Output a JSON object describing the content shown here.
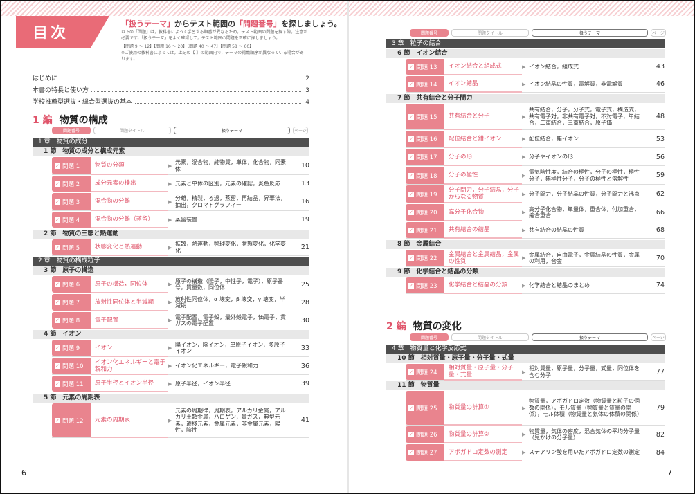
{
  "left": {
    "title": "目次",
    "header": {
      "a": "「扱うテーマ」",
      "b": "からテスト範囲の",
      "c": "「問題番号」",
      "d": "を探しましょう。"
    },
    "notes": [
      "以下の「問題」は，教科書によって学習する順番が異なるため，テスト範囲の問題を探す際，注意が",
      "必要です。「扱うテーマ」をよく確認して，テスト範囲の問題を正確に探しましょう。",
      "【問題 9 ～ 12】【問題 16 ～ 20】【問題 40 ～ 47】【問題 58 ～ 60】",
      "※ご使用の教科書によっては，上記の【 】の範囲内で，テーマの掲載順序が異なっている場合があ",
      "ります。"
    ],
    "toc": [
      {
        "t": "はじめに",
        "p": "2"
      },
      {
        "t": "本書の特長と使い方",
        "p": "3"
      },
      {
        "t": "学校推薦型選抜・総合型選抜の基本",
        "p": "4"
      }
    ],
    "part": {
      "num": "1 編",
      "title": "物質の構成"
    },
    "legend": {
      "num": "問題番号",
      "title": "問題タイトル",
      "theme": "扱うテーマ",
      "page": "ページ"
    },
    "chapter1": "1 章　物質の成分",
    "sec1": "1 節　物質の成分と構成元素",
    "r1": {
      "n": "問題 1",
      "t": "物質の分類",
      "th": "元素，混合物，純物質，単体，化合物，同素体",
      "p": "10"
    },
    "r2": {
      "n": "問題 2",
      "t": "成分元素の検出",
      "th": "元素と単体の区別，元素の確認，炎色反応",
      "p": "13"
    },
    "r3": {
      "n": "問題 3",
      "t": "混合物の分離",
      "th": "分離，精製，ろ過，蒸留，再結晶，昇華法，抽出，クロマトグラフィー",
      "p": "16"
    },
    "r4": {
      "n": "問題 4",
      "t": "混合物の分離（蒸留）",
      "th": "蒸留装置",
      "p": "19"
    },
    "sec2": "2 節　物質の三態と熱運動",
    "r5": {
      "n": "問題 5",
      "t": "状態変化と熱運動",
      "th": "拡散，熱運動，物理変化，状態変化，化学変化",
      "p": "21"
    },
    "chapter2": "2 章　物質の構成粒子",
    "sec3": "3 節　原子の構造",
    "r6": {
      "n": "問題 6",
      "t": "原子の構造，同位体",
      "th": "原子の構造（陽子，中性子，電子），原子番号，質量数，同位体",
      "p": "25"
    },
    "r7": {
      "n": "問題 7",
      "t": "放射性同位体と半減期",
      "th": "放射性同位体，α 壊変，β 壊変，γ 壊変，半減期",
      "p": "28"
    },
    "r8": {
      "n": "問題 8",
      "t": "電子配置",
      "th": "電子配置，電子殻，最外殻電子，価電子，貴ガスの電子配置",
      "p": "30"
    },
    "sec4": "4 節　イオン",
    "r9": {
      "n": "問題 9",
      "t": "イオン",
      "th": "陽イオン，陰イオン，単原子イオン，多原子イオン",
      "p": "33"
    },
    "r10": {
      "n": "問題 10",
      "t": "イオン化エネルギーと電子親和力",
      "th": "イオン化エネルギー，電子親和力",
      "p": "36"
    },
    "r11": {
      "n": "問題 11",
      "t": "原子半径とイオン半径",
      "th": "原子半径，イオン半径",
      "p": "39"
    },
    "sec5": "5 節　元素の周期表",
    "r12": {
      "n": "問題 12",
      "t": "元素の周期表",
      "th": "元素の周期律，周期表，アルカリ金属，アルカリ土類金属，ハロゲン，貴ガス，典型元素，遷移元素，金属元素，非金属元素，陽性，陰性",
      "p": "41"
    },
    "folio": "6"
  },
  "right": {
    "legend": {
      "num": "問題番号",
      "title": "問題タイトル",
      "theme": "扱うテーマ",
      "page": "ページ"
    },
    "chapter3": "3 章　粒子の結合",
    "sec6": "6 節　イオン結合",
    "r13": {
      "n": "問題 13",
      "t": "イオン結合と組成式",
      "th": "イオン結合，組成式",
      "p": "43"
    },
    "r14": {
      "n": "問題 14",
      "t": "イオン結晶",
      "th": "イオン結晶の性質，電解質，非電解質",
      "p": "46"
    },
    "sec7": "7 節　共有結合と分子間力",
    "r15": {
      "n": "問題 15",
      "t": "共有結合と分子",
      "th": "共有結合，分子，分子式，電子式，構造式，共有電子対，非共有電子対，不対電子，単結合，二重結合，三重結合，原子価",
      "p": "48"
    },
    "r16": {
      "n": "問題 16",
      "t": "配位結合と錯イオン",
      "th": "配位結合，錯イオン",
      "p": "53"
    },
    "r17": {
      "n": "問題 17",
      "t": "分子の形",
      "th": "分子やイオンの形",
      "p": "56"
    },
    "r18": {
      "n": "問題 18",
      "t": "分子の極性",
      "th": "電気陰性度，結合の極性，分子の極性，極性分子，無極性分子，分子の極性と溶解性",
      "p": "59"
    },
    "r19": {
      "n": "問題 19",
      "t": "分子間力，分子結晶，分子からなる物質",
      "th": "分子間力，分子結晶の性質，分子間力と沸点",
      "p": "62"
    },
    "r20": {
      "n": "問題 20",
      "t": "高分子化合物",
      "th": "高分子化合物，単量体，重合体，付加重合，縮合重合",
      "p": "66"
    },
    "r21": {
      "n": "問題 21",
      "t": "共有結合の結晶",
      "th": "共有結合の結晶の性質",
      "p": "68"
    },
    "sec8": "8 節　金属結合",
    "r22": {
      "n": "問題 22",
      "t": "金属結合と金属結晶，金属の性質",
      "th": "金属結合，自由電子，金属結晶の性質，金属の利用，合金",
      "p": "70"
    },
    "sec9": "9 節　化学結合と結晶の分類",
    "r23": {
      "n": "問題 23",
      "t": "化学結合と結晶の分類",
      "th": "化学結合と結晶のまとめ",
      "p": "74"
    },
    "part": {
      "num": "2 編",
      "title": "物質の変化"
    },
    "chapter4": "4 章　物質量と化学反応式",
    "sec10": "10 節　相対質量・原子量・分子量・式量",
    "r24": {
      "n": "問題 24",
      "t": "相対質量・原子量・分子量・式量",
      "th": "相対質量，原子量，分子量，式量，同位体を含む分子",
      "p": "77"
    },
    "sec11": "11 節　物質量",
    "r25": {
      "n": "問題 25",
      "t": "物質量の計算①",
      "th": "物質量，アボガドロ定数（物質量と粒子の個数の関係），モル質量（物質量と質量の関係），モル体積（物質量と気体の体積の関係）",
      "p": "79"
    },
    "r26": {
      "n": "問題 26",
      "t": "物質量の計算②",
      "th": "物質量，気体の密度，混合気体の平均分子量（見かけの分子量）",
      "p": "82"
    },
    "r27": {
      "n": "問題 27",
      "t": "アボガドロ定数の測定",
      "th": "ステアリン酸を用いたアボガドロ定数の測定",
      "p": "84"
    },
    "folio": "7"
  }
}
